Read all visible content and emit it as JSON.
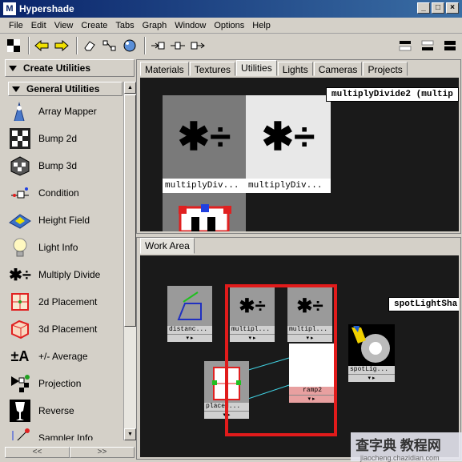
{
  "window": {
    "title": "Hypershade",
    "min": "_",
    "max": "□",
    "close": "×"
  },
  "menu": [
    "File",
    "Edit",
    "View",
    "Create",
    "Tabs",
    "Graph",
    "Window",
    "Options",
    "Help"
  ],
  "left_panel": {
    "header": "Create Utilities",
    "subheader": "General Utilities",
    "items": [
      {
        "label": "Array Mapper",
        "icon": "array-mapper-icon"
      },
      {
        "label": "Bump 2d",
        "icon": "bump-2d-icon"
      },
      {
        "label": "Bump 3d",
        "icon": "bump-3d-icon"
      },
      {
        "label": "Condition",
        "icon": "condition-icon"
      },
      {
        "label": "Height Field",
        "icon": "height-field-icon"
      },
      {
        "label": "Light Info",
        "icon": "light-info-icon"
      },
      {
        "label": "Multiply Divide",
        "icon": "multiply-divide-icon"
      },
      {
        "label": "2d Placement",
        "icon": "2d-placement-icon"
      },
      {
        "label": "3d Placement",
        "icon": "3d-placement-icon"
      },
      {
        "label": "+/- Average",
        "icon": "plus-minus-average-icon"
      },
      {
        "label": "Projection",
        "icon": "projection-icon"
      },
      {
        "label": "Reverse",
        "icon": "reverse-icon"
      },
      {
        "label": "Sampler Info",
        "icon": "sampler-info-icon"
      }
    ],
    "nav": [
      "<<",
      ">>"
    ]
  },
  "top_panel": {
    "tabs": [
      "Materials",
      "Textures",
      "Utilities",
      "Lights",
      "Cameras",
      "Projects"
    ],
    "active_tab": "Utilities",
    "nodes": [
      {
        "label": "multiplyDiv...",
        "symbol": "✱÷"
      },
      {
        "label": "multiplyDiv...",
        "symbol": "✱÷"
      }
    ],
    "tooltip": "multiplyDivide2 (multip"
  },
  "work_area": {
    "tab": "Work Area",
    "nodes": [
      {
        "label": "distanc..."
      },
      {
        "label": "multipl..."
      },
      {
        "label": "multipl..."
      },
      {
        "label": "spotLig..."
      },
      {
        "label": "ramp2"
      },
      {
        "label": "placed..."
      }
    ],
    "tooltip": "spotLightSha"
  },
  "watermark": {
    "line1": "查字典 教程网",
    "line2": "jiaocheng.chazidian.com"
  },
  "colors": {
    "title_start": "#0a246a",
    "title_end": "#3a6ea5",
    "highlight": "#e11b1b",
    "canvas": "#1a1a1a"
  }
}
